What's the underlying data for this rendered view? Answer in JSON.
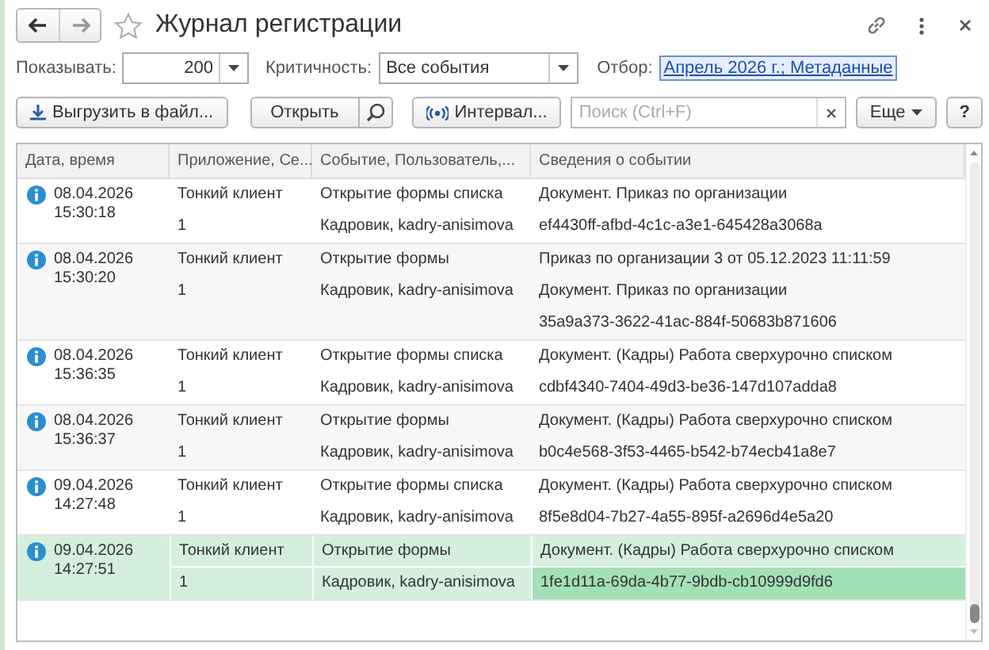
{
  "window": {
    "title": "Журнал регистрации"
  },
  "filters": {
    "show_label": "Показывать:",
    "show_value": "200",
    "level_label": "Критичность:",
    "level_value": "Все события",
    "filter_label": "Отбор:",
    "filter_link": "Апрель 2026 г.; Метаданные"
  },
  "toolbar": {
    "export": "Выгрузить в файл...",
    "open": "Открыть",
    "interval": "Интервал...",
    "search_placeholder": "Поиск (Ctrl+F)",
    "more": "Еще",
    "help": "?"
  },
  "table": {
    "columns": [
      "Дата, время",
      "Приложение, Се...",
      "Событие, Пользователь,...",
      "Сведения о событии"
    ],
    "rows": [
      {
        "date": "08.04.2026",
        "time": "15:30:18",
        "app": "Тонкий клиент",
        "session": "1",
        "event": "Открытие формы списка",
        "user": "Кадровик, kadry-anisimova",
        "details": [
          "Документ. Приказ по организации",
          "ef4430ff-afbd-4c1c-a3e1-645428a3068a"
        ],
        "selected": false
      },
      {
        "date": "08.04.2026",
        "time": "15:30:20",
        "app": "Тонкий клиент",
        "session": "1",
        "event": "Открытие формы",
        "user": "Кадровик, kadry-anisimova",
        "details": [
          "Приказ по организации 3 от 05.12.2023 11:11:59",
          "Документ. Приказ по организации",
          "35a9a373-3622-41ac-884f-50683b871606"
        ],
        "selected": false
      },
      {
        "date": "08.04.2026",
        "time": "15:36:35",
        "app": "Тонкий клиент",
        "session": "1",
        "event": "Открытие формы списка",
        "user": "Кадровик, kadry-anisimova",
        "details": [
          "Документ. (Кадры) Работа сверхурочно списком",
          "cdbf4340-7404-49d3-be36-147d107adda8"
        ],
        "selected": false
      },
      {
        "date": "08.04.2026",
        "time": "15:36:37",
        "app": "Тонкий клиент",
        "session": "1",
        "event": "Открытие формы",
        "user": "Кадровик, kadry-anisimova",
        "details": [
          "Документ. (Кадры) Работа сверхурочно списком",
          "b0c4e568-3f53-4465-b542-b74ecb41a8e7"
        ],
        "selected": false
      },
      {
        "date": "09.04.2026",
        "time": "14:27:48",
        "app": "Тонкий клиент",
        "session": "1",
        "event": "Открытие формы списка",
        "user": "Кадровик, kadry-anisimova",
        "details": [
          "Документ. (Кадры) Работа сверхурочно списком",
          "8f5e8d04-7b27-4a55-895f-a2696d4e5a20"
        ],
        "selected": false
      },
      {
        "date": "09.04.2026",
        "time": "14:27:51",
        "app": "Тонкий клиент",
        "session": "1",
        "event": "Открытие формы",
        "user": "Кадровик, kadry-anisimova",
        "details": [
          "Документ. (Кадры) Работа сверхурочно списком",
          "1fe1d11a-69da-4b77-9bdb-cb10999d9fd6"
        ],
        "selected": true
      }
    ]
  }
}
